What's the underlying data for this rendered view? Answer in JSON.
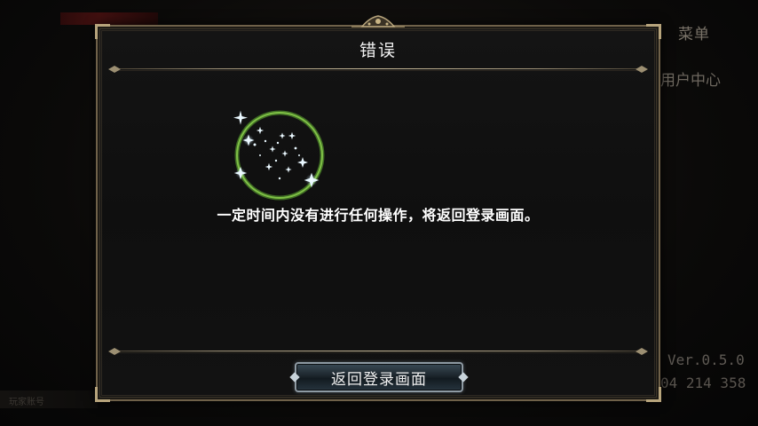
{
  "background": {
    "menu_label": "菜单",
    "user_center_label": "用户中心",
    "version": "Ver.0.5.0",
    "server_address": "04 214 358",
    "bottom_text": "玩家账号"
  },
  "dialog": {
    "title": "错误",
    "message": "一定时间内没有进行任何操作，将返回登录画面。",
    "return_button_label": "返回登录画面"
  },
  "colors": {
    "frame_gold": "#b7a47c",
    "spinner_ring": "#6fae3c",
    "button_border": "#8e9aa3"
  },
  "icons": {
    "spinner": "sparkle-loading-ring-icon"
  }
}
